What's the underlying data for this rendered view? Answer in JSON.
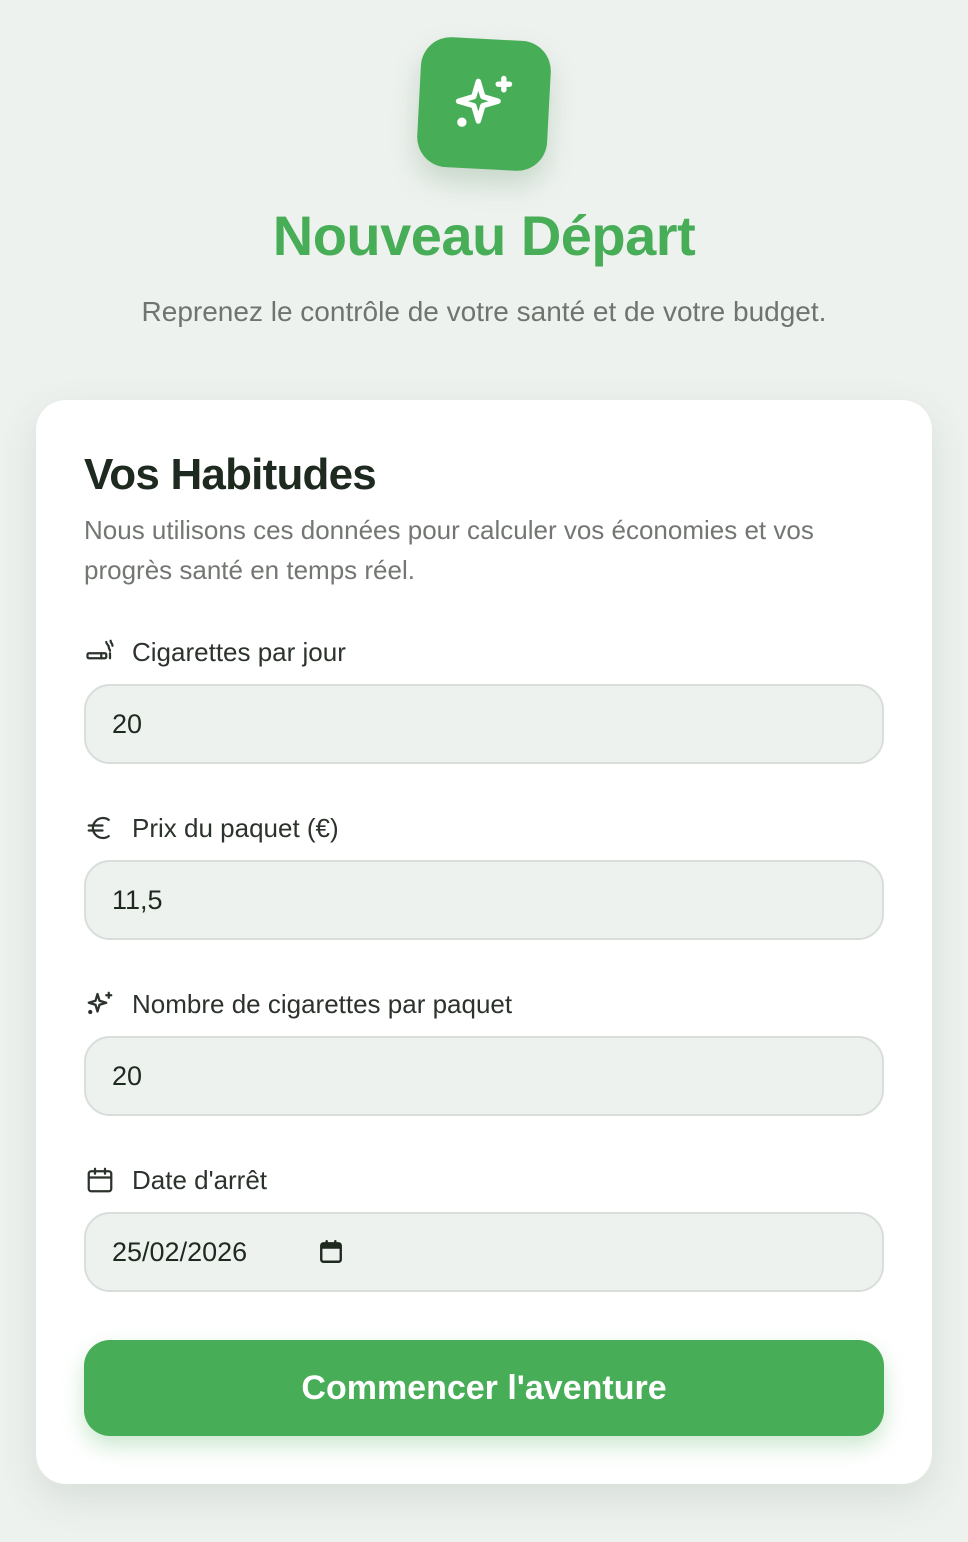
{
  "header": {
    "logo_icon": "sparkles-icon",
    "title": "Nouveau Départ",
    "subtitle": "Reprenez le contrôle de votre santé et de votre budget."
  },
  "form": {
    "title": "Vos Habitudes",
    "description": "Nous utilisons ces données pour calculer vos économies et vos progrès santé en temps réel.",
    "fields": [
      {
        "label": "Cigarettes par jour",
        "icon": "cigarette-icon",
        "value": "20"
      },
      {
        "label": "Prix du paquet (€)",
        "icon": "euro-icon",
        "value": "11,5"
      },
      {
        "label": "Nombre de cigarettes par paquet",
        "icon": "sparkles-icon",
        "value": "20"
      },
      {
        "label": "Date d'arrêt",
        "icon": "calendar-icon",
        "value": "25/02/2026"
      }
    ],
    "submit_label": "Commencer l'aventure"
  },
  "colors": {
    "accent": "#47ad57",
    "background": "#eef2ef",
    "card": "#ffffff",
    "text": "#1e2a1f",
    "muted": "#727772"
  }
}
